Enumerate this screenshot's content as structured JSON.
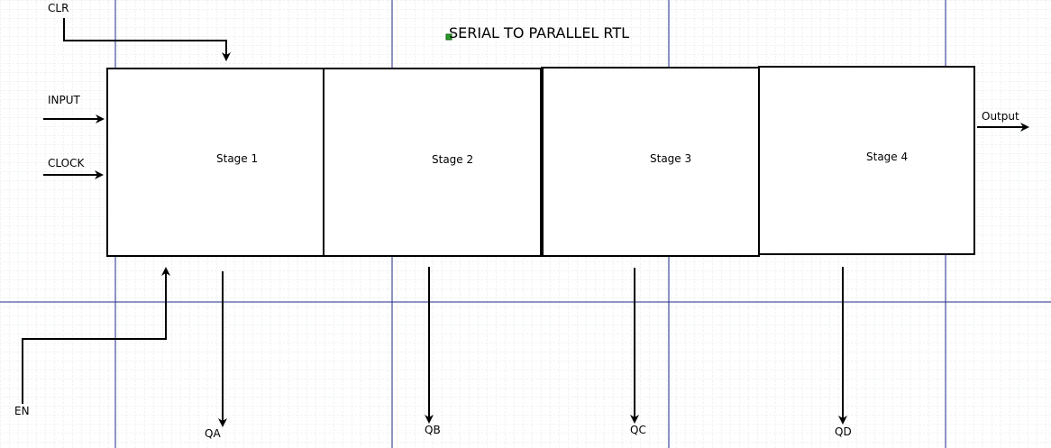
{
  "title": "SERIAL TO PARALLEL RTL",
  "colors": {
    "grid_minor": "#cfe0e3",
    "page_break": "#1f2a8a",
    "stroke": "#000000",
    "handle": "#2a9d2a"
  },
  "stages": [
    {
      "label": "Stage 1"
    },
    {
      "label": "Stage 2"
    },
    {
      "label": "Stage 3"
    },
    {
      "label": "Stage 4"
    }
  ],
  "signals": {
    "clr": "CLR",
    "input": "INPUT",
    "clock": "CLOCK",
    "en": "EN",
    "output": "Output",
    "qa": "QA",
    "qb": "QB",
    "qc": "QC",
    "qd": "QD"
  }
}
